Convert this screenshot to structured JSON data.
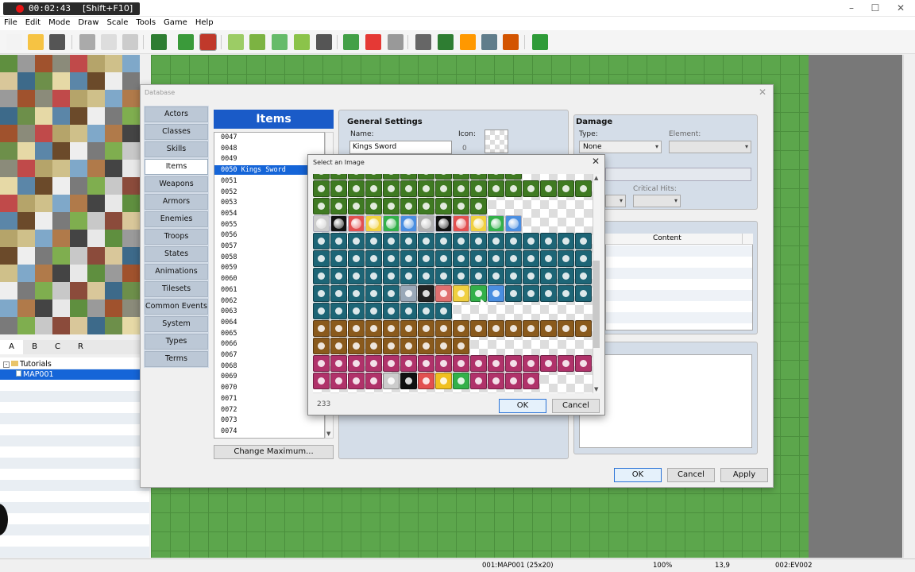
{
  "recorder": {
    "time": "00:02:43",
    "shortcut": "[Shift+F10]"
  },
  "window": {
    "minimize": "–",
    "maximize": "☐",
    "close": "✕"
  },
  "menu": [
    "File",
    "Edit",
    "Mode",
    "Draw",
    "Scale",
    "Tools",
    "Game",
    "Help"
  ],
  "toolbar_icons": [
    "new-icon",
    "open-icon",
    "save-icon",
    "cut-icon",
    "copy-icon",
    "paste-icon",
    "undo-icon",
    "map-mode-icon",
    "event-mode-icon",
    "pencil-icon",
    "rectangle-icon",
    "ellipse-icon",
    "fill-icon",
    "shadow-pen-icon",
    "zoom-in-icon",
    "zoom-out-icon",
    "zoom-actual-icon",
    "database-icon",
    "plugin-icon",
    "sound-icon",
    "resource-icon",
    "character-generator-icon",
    "playtest-icon"
  ],
  "palette_tabs": [
    "A",
    "B",
    "C",
    "R"
  ],
  "map_tree": {
    "root": "Tutorials",
    "map": "MAP001"
  },
  "status": {
    "map": "001:MAP001 (25x20)",
    "zoom": "100%",
    "coords": "13,9",
    "event": "002:EV002"
  },
  "database": {
    "title": "Database",
    "close": "✕",
    "categories": [
      "Actors",
      "Classes",
      "Skills",
      "Items",
      "Weapons",
      "Armors",
      "Enemies",
      "Troops",
      "States",
      "Animations",
      "Tilesets",
      "Common Events",
      "System",
      "Types",
      "Terms"
    ],
    "selected_category": "Items",
    "list_title": "Items",
    "items": [
      "0047",
      "0048",
      "0049",
      "0050 Kings Sword",
      "0051",
      "0052",
      "0053",
      "0054",
      "0055",
      "0056",
      "0057",
      "0058",
      "0059",
      "0060",
      "0061",
      "0062",
      "0063",
      "0064",
      "0065",
      "0066",
      "0067",
      "0068",
      "0069",
      "0070",
      "0071",
      "0072",
      "0073",
      "0074"
    ],
    "change_max": "Change Maximum...",
    "general": {
      "title": "General Settings",
      "name_label": "Name:",
      "name_value": "Kings Sword",
      "icon_label": "Icon:",
      "icon_value": "0"
    },
    "damage": {
      "title": "Damage",
      "type_label": "Type:",
      "type_value": "None",
      "element_label": "Element:",
      "critical_label": "Critical Hits:"
    },
    "effects_header": "Content",
    "buttons": {
      "ok": "OK",
      "cancel": "Cancel",
      "apply": "Apply"
    }
  },
  "select_image": {
    "title": "Select an Image",
    "close": "✕",
    "count": "233",
    "ok": "OK",
    "cancel": "Cancel",
    "colors": {
      "green": "#3f7a22",
      "teal": "#1d6576",
      "brown": "#8a5a1c",
      "magenta": "#b0326a"
    }
  }
}
